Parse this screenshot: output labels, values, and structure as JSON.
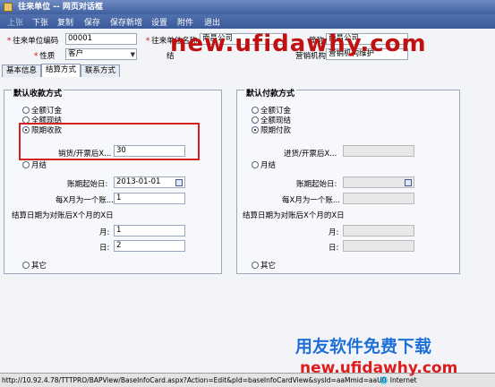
{
  "window": {
    "title": "往来单位 -- 网页对话框"
  },
  "menu": [
    "上张",
    "下张",
    "复制",
    "保存",
    "保存新增",
    "设置",
    "附件",
    "退出"
  ],
  "top_form": {
    "code_label": "往来单位编码",
    "code_value": "00001",
    "nature_label": "性质",
    "nature_value": "客户",
    "name_label": "往来单位名称",
    "name_value": "南昌公司",
    "short_label": "简称",
    "short_value": "南昌公司",
    "settle_label": "结",
    "org_label": "营销机构",
    "org_value": "营销机构维护"
  },
  "tabs": [
    "基本信息",
    "结算方式",
    "联系方式"
  ],
  "receipt": {
    "title": "默认收款方式",
    "full_order": "全额订金",
    "full_settle": "全额现结",
    "period": "限期收款",
    "after_label": "销货/开票后X...",
    "after_value": "30",
    "monthly": "月结",
    "start_label": "账期起始日:",
    "start_value": "2013-01-01",
    "every_label": "每X月为一个账...",
    "every_value": "1",
    "settle_day_label": "结算日期为对账后X个月的X日",
    "month_label": "月:",
    "month_value": "1",
    "day_label": "日:",
    "day_value": "2",
    "other": "其它"
  },
  "payment": {
    "title": "默认付款方式",
    "full_order": "全额订金",
    "full_settle": "全额现结",
    "period": "限期付款",
    "after_label": "进货/开票后X...",
    "monthly": "月结",
    "start_label": "账期起始日:",
    "every_label": "每X月为一个账...",
    "settle_day_label": "结算日期为对账后X个月的X日",
    "month_label": "月:",
    "day_label": "日:",
    "other": "其它"
  },
  "status": {
    "url": "http://10.92.4.78/TTTPRO/BAPView/BaseInfoCard.aspx?Action=Edit&pId=baseInfoCardView&sysId=aaMmid=aaU0",
    "zone": "Internet"
  },
  "watermarks": {
    "top": "new.ufidawhy.com",
    "cn": "用友软件免费下载",
    "bottom": "new.ufidawhy.com"
  },
  "colors": {
    "titlebar": "#4f6fae",
    "highlight_box": "#d62020",
    "watermark_red": "#c01010",
    "watermark_blue": "#1e6fd6"
  }
}
